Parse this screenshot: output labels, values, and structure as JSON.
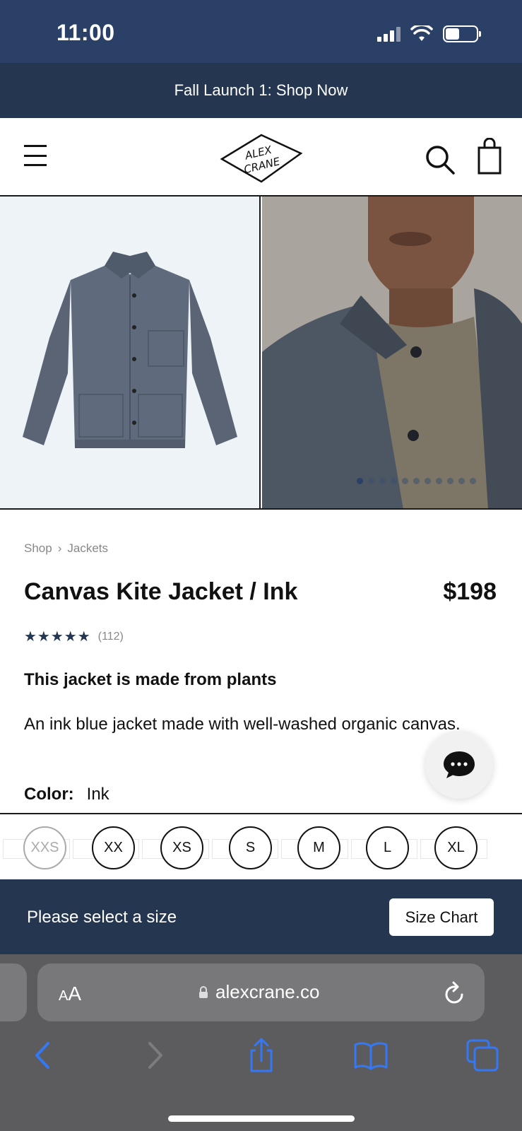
{
  "status_bar": {
    "time": "11:00"
  },
  "announcement": {
    "text": "Fall Launch 1: Shop Now"
  },
  "header": {
    "logo_text_line1": "ALEX",
    "logo_text_line2": "CRANE"
  },
  "breadcrumb": {
    "items": [
      "Shop",
      "Jackets"
    ],
    "separator": "›"
  },
  "product": {
    "title": "Canvas Kite Jacket / Ink",
    "price": "$198",
    "stars": "★★★★★",
    "rating_count": "(112)",
    "subheadline": "This jacket is made from plants",
    "description": "An ink blue jacket made with well-washed organic canvas.",
    "color_label": "Color:",
    "color_value": "Ink"
  },
  "gallery": {
    "dot_count": 11,
    "active_dot": 0
  },
  "sizes": [
    {
      "label": "XXS",
      "available": false
    },
    {
      "label": "XX",
      "available": true
    },
    {
      "label": "XS",
      "available": true
    },
    {
      "label": "S",
      "available": true
    },
    {
      "label": "M",
      "available": true
    },
    {
      "label": "L",
      "available": true
    },
    {
      "label": "XL",
      "available": true
    }
  ],
  "size_banner": {
    "prompt": "Please select a size",
    "size_chart_label": "Size Chart"
  },
  "browser": {
    "aa_small": "A",
    "aa_big": "A",
    "url": "alexcrane.co"
  },
  "colors": {
    "navy": "#243650",
    "status_navy": "#2b4067",
    "ios_blue": "#3478f6"
  },
  "icons": [
    "menu-icon",
    "search-icon",
    "bag-icon",
    "chat-icon",
    "lock-icon",
    "reload-icon",
    "back-icon",
    "forward-icon",
    "share-icon",
    "bookmarks-icon",
    "tabs-icon"
  ]
}
